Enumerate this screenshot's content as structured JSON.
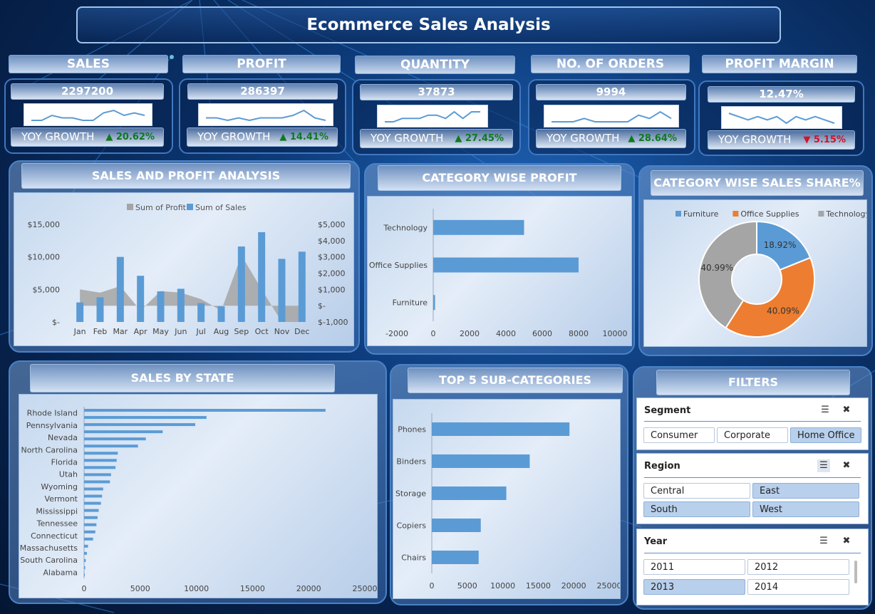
{
  "title": "Ecommerce Sales Analysis",
  "kpis": [
    {
      "label": "SALES",
      "value": "2297200",
      "yoy_label": "YOY GROWTH",
      "yoy": "20.62%",
      "dir": "up",
      "spark": [
        3,
        3,
        5,
        4,
        4,
        3,
        3,
        6,
        7,
        5,
        6,
        5
      ]
    },
    {
      "label": "PROFIT",
      "value": "286397",
      "yoy_label": "YOY GROWTH",
      "yoy": "14.41%",
      "dir": "up",
      "spark": [
        5,
        5,
        4,
        5,
        4,
        5,
        5,
        5,
        6,
        8,
        5,
        4
      ]
    },
    {
      "label": "QUANTITY",
      "value": "37873",
      "yoy_label": "YOY GROWTH",
      "yoy": "27.45%",
      "dir": "up",
      "spark": [
        3,
        3,
        4,
        4,
        4,
        5,
        5,
        4,
        6,
        4,
        6,
        6
      ]
    },
    {
      "label": "NO. OF ORDERS",
      "value": "9994",
      "yoy_label": "YOY GROWTH",
      "yoy": "28.64%",
      "dir": "up",
      "spark": [
        3,
        3,
        3,
        4,
        3,
        3,
        3,
        3,
        5,
        4,
        6,
        4
      ]
    },
    {
      "label": "PROFIT MARGIN",
      "value": "12.47%",
      "yoy_label": "YOY GROWTH",
      "yoy": "5.15%",
      "dir": "down",
      "spark": [
        7,
        6,
        5,
        6,
        5,
        6,
        4,
        6,
        5,
        6,
        5,
        4
      ]
    }
  ],
  "panels": {
    "sales_profit": "SALES AND PROFIT ANALYSIS",
    "category_profit": "CATEGORY WISE PROFIT",
    "category_share": "CATEGORY WISE SALES SHARE%",
    "sales_state": "SALES  BY STATE",
    "top5": "TOP 5 SUB-CATEGORIES",
    "filters": "FILTERS"
  },
  "chart_data": [
    {
      "type": "bar",
      "legend": [
        "Sum of Profit",
        "Sum of Sales"
      ],
      "categories": [
        "Jan",
        "Feb",
        "Mar",
        "Apr",
        "May",
        "Jun",
        "Jul",
        "Aug",
        "Sep",
        "Oct",
        "Nov",
        "Dec"
      ],
      "series": [
        {
          "name": "Sum of Sales",
          "type": "bar",
          "axis": "left",
          "values": [
            3000,
            3800,
            10000,
            7100,
            4700,
            5100,
            2900,
            2400,
            11600,
            13800,
            9700,
            10800
          ]
        },
        {
          "name": "Sum of Profit",
          "type": "area",
          "axis": "right",
          "values": [
            1000,
            800,
            1200,
            -300,
            900,
            800,
            400,
            -300,
            3100,
            1000,
            -1000,
            -1000
          ]
        }
      ],
      "left_ticks": [
        "$15,000",
        "$10,000",
        "$5,000",
        "$-"
      ],
      "left_range": [
        0,
        15000
      ],
      "right_ticks": [
        "$5,000",
        "$4,000",
        "$3,000",
        "$2,000",
        "$1,000",
        "$-",
        "$-1,000"
      ],
      "right_range": [
        -1000,
        5000
      ]
    },
    {
      "type": "bar",
      "orientation": "horizontal",
      "categories": [
        "Technology",
        "Office Supplies",
        "Furniture"
      ],
      "values": [
        5000,
        8000,
        100
      ],
      "x_ticks": [
        "-2000",
        "0",
        "2000",
        "4000",
        "6000",
        "8000",
        "10000"
      ],
      "xlim": [
        -2000,
        10000
      ]
    },
    {
      "type": "pie",
      "donut": true,
      "legend": [
        "Furniture",
        "Office Supplies",
        "Technology"
      ],
      "values": [
        18.92,
        40.09,
        40.99
      ],
      "labels": [
        "18.92%",
        "40.09%",
        "40.99%"
      ],
      "colors": [
        "#5b9bd5",
        "#ed7d31",
        "#a5a5a5"
      ]
    },
    {
      "type": "bar",
      "orientation": "horizontal",
      "label_categories": [
        "Rhode Island",
        "Pennsylvania",
        "Nevada",
        "North Carolina",
        "Florida",
        "Utah",
        "Wyoming",
        "Vermont",
        "Mississippi",
        "Tennessee",
        "Connecticut",
        "Massachusetts",
        "South Carolina",
        "Alabama"
      ],
      "values": [
        21500,
        10900,
        9900,
        7000,
        5500,
        4800,
        3000,
        2900,
        2800,
        2400,
        2300,
        1700,
        1600,
        1500,
        1300,
        1200,
        1100,
        1000,
        800,
        350,
        250,
        150,
        100,
        50
      ],
      "x_ticks": [
        "0",
        "5000",
        "10000",
        "15000",
        "20000",
        "25000"
      ],
      "xlim": [
        0,
        25000
      ]
    },
    {
      "type": "bar",
      "orientation": "horizontal",
      "categories": [
        "Phones",
        "Binders",
        "Storage",
        "Copiers",
        "Chairs"
      ],
      "values": [
        19400,
        13800,
        10500,
        6900,
        6600
      ],
      "x_ticks": [
        "0",
        "5000",
        "10000",
        "15000",
        "20000",
        "25000"
      ],
      "xlim": [
        0,
        25000
      ]
    }
  ],
  "filters": {
    "segment": {
      "title": "Segment",
      "options": [
        {
          "label": "Consumer",
          "selected": false
        },
        {
          "label": "Corporate",
          "selected": false
        },
        {
          "label": "Home Office",
          "selected": true
        }
      ]
    },
    "region": {
      "title": "Region",
      "options": [
        {
          "label": "Central",
          "selected": false
        },
        {
          "label": "East",
          "selected": true
        },
        {
          "label": "South",
          "selected": true
        },
        {
          "label": "West",
          "selected": true
        }
      ]
    },
    "year": {
      "title": "Year",
      "options": [
        {
          "label": "2011",
          "selected": false
        },
        {
          "label": "2012",
          "selected": false
        },
        {
          "label": "2013",
          "selected": true
        },
        {
          "label": "2014",
          "selected": false
        }
      ]
    }
  },
  "icons": {
    "multiselect": "multi-select-icon",
    "clear": "clear-filter-icon"
  },
  "colors": {
    "bar": "#5b9bd5",
    "area": "#a5a5a5",
    "up": "#0e7a1e",
    "down": "#d0142a"
  }
}
